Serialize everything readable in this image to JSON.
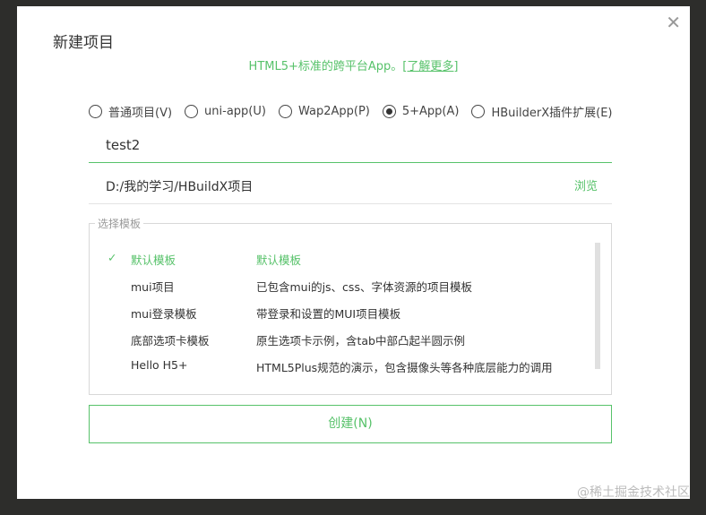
{
  "dialog": {
    "title": "新建项目",
    "close": "✕"
  },
  "subtitle": {
    "text": "HTML5+标准的跨平台App。",
    "link": "[了解更多]"
  },
  "radios": [
    {
      "label": "普通项目(V)",
      "checked": false
    },
    {
      "label": "uni-app(U)",
      "checked": false
    },
    {
      "label": "Wap2App(P)",
      "checked": false
    },
    {
      "label": "5+App(A)",
      "checked": true
    },
    {
      "label": "HBuilderX插件扩展(E)",
      "checked": false
    }
  ],
  "project_name": "test2",
  "path": {
    "value": "D:/我的学习/HBuildX项目",
    "browse": "浏览"
  },
  "templates": {
    "legend": "选择模板",
    "check": "✓",
    "items": [
      {
        "name": "默认模板",
        "desc": "默认模板"
      },
      {
        "name": "mui项目",
        "desc": "已包含mui的js、css、字体资源的项目模板"
      },
      {
        "name": "mui登录模板",
        "desc": "带登录和设置的MUI项目模板"
      },
      {
        "name": "底部选项卡模板",
        "desc": "原生选项卡示例，含tab中部凸起半圆示例"
      },
      {
        "name": "Hello H5+",
        "desc": "HTML5Plus规范的演示，包含摄像头等各种底层能力的调用"
      }
    ]
  },
  "create_button": "创建(N)",
  "watermark": "@稀土掘金技术社区"
}
